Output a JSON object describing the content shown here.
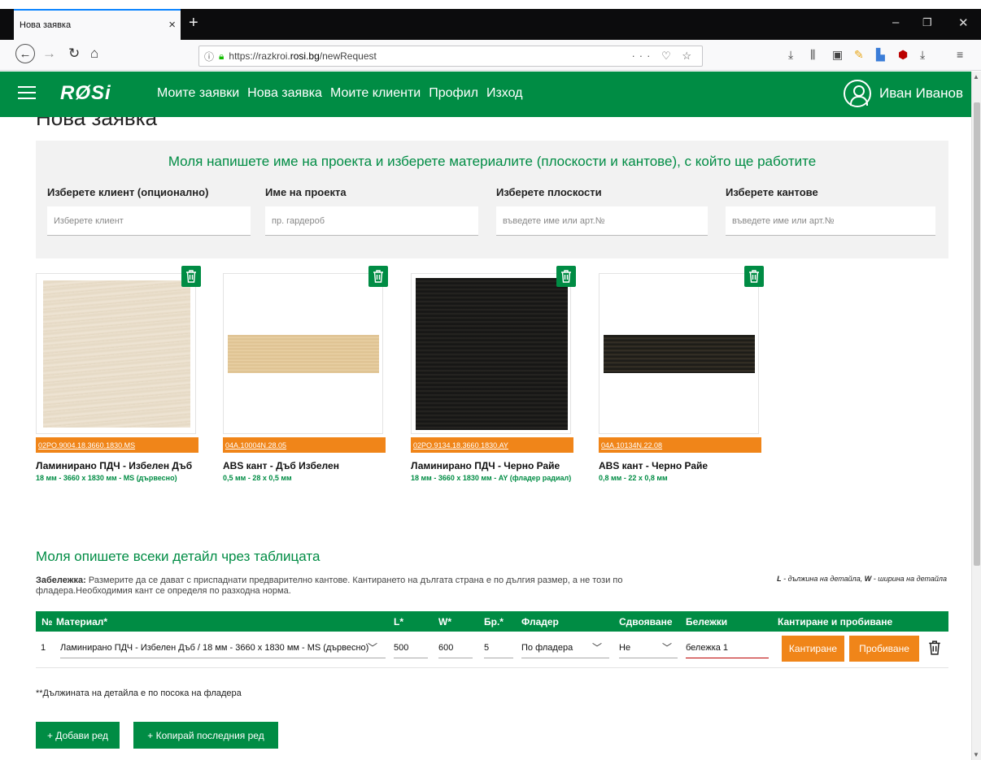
{
  "browser": {
    "tab_title": "Нова заявка",
    "tab_close": "×",
    "new_tab": "+",
    "url_scheme": "https://razkroi.",
    "url_host": "rosi.bg",
    "url_path": "/newRequest",
    "url_icons": "··· ♡ ☆"
  },
  "nav": {
    "logo": "RØSi",
    "links": [
      "Моите заявки",
      "Нова заявка",
      "Моите клиенти",
      "Профил",
      "Изход"
    ],
    "user_name": "Иван Иванов"
  },
  "page": {
    "title": "Нова заявка",
    "form_heading": "Моля напишете име на проекта и изберете материалите (плоскости и кантове), с който ще работите",
    "fields": [
      {
        "label": "Изберете клиент (опционално)",
        "placeholder": "Изберете клиент"
      },
      {
        "label": "Име на проекта",
        "placeholder": "пр. гардероб"
      },
      {
        "label": "Изберете плоскости",
        "placeholder": "въведете име или арт.№"
      },
      {
        "label": "Изберете кантове",
        "placeholder": "въведете име или арт.№"
      }
    ]
  },
  "materials": [
    {
      "code": "02PO.9004.18.3660.1830.MS",
      "name": "Ламинирано ПДЧ - Избелен Дъб",
      "desc": "18 мм - 3660 x 1830 мм - MS (дървесно)",
      "swatch_color": "#e8dcc8"
    },
    {
      "code": "04A.10004N.28.05",
      "name": "ABS кант - Дъб Избелен",
      "desc": "0,5 мм - 28 x 0,5 мм",
      "swatch_color": "#e2c79b"
    },
    {
      "code": "02PO.9134.18.3660.1830.AY",
      "name": "Ламинирано ПДЧ - Черно Райе",
      "desc": "18 мм - 3660 x 1830 мм - AY (фладер радиал)",
      "swatch_color": "#1b1a18"
    },
    {
      "code": "04A.10134N.22.08",
      "name": "ABS кант - Черно Райе",
      "desc": "0,8 мм - 22 x 0,8 мм",
      "swatch_color": "#1f1d18"
    }
  ],
  "details": {
    "heading": "Моля опишете всеки детайл чрез таблицата",
    "note_bold": "Забележка:",
    "note_text": " Размерите да се дават с приспаднати предварително кантове. Кантирането на дългата страна е по дългия размер, а не този по фладера.Необходимия кант се определя по разходна норма.",
    "legend_L": "L",
    "legend_L_text": " - дължина на детайла, ",
    "legend_W": "W",
    "legend_W_text": " - ширина на детайла",
    "columns": [
      "№",
      "Материал*",
      "L*",
      "W*",
      "Бр.*",
      "Фладер",
      "Сдвояване",
      "Бележки",
      "Кантиране и пробиване"
    ],
    "rows": [
      {
        "no": "1",
        "material": "Ламинирано ПДЧ - Избелен Дъб / 18 мм - 3660 x 1830 мм - MS (дървесно)",
        "L": "500",
        "W": "600",
        "qty": "5",
        "grain": "По фладера",
        "pairing": "Не",
        "notes": "бележка 1",
        "edge_btn": "Кантиране",
        "drill_btn": "Пробиване"
      }
    ],
    "footnote": "**Дължината на детайла е по посока на фладера",
    "add_row": "+ Добави ред",
    "copy_row": "+ Копирай последния ред"
  },
  "colors": {
    "brand_green": "#008c44",
    "accent_orange": "#f08519"
  }
}
